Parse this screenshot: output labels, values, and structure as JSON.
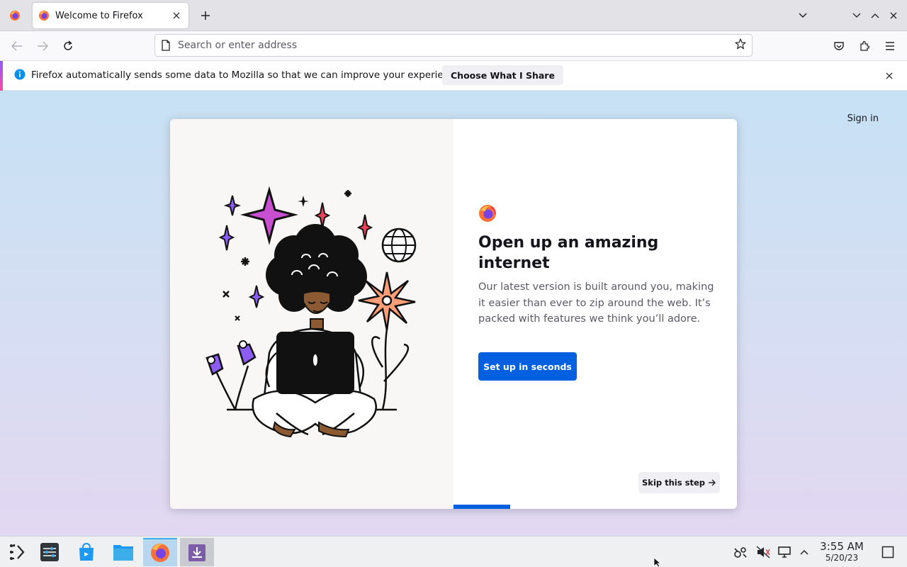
{
  "browser": {
    "tab": {
      "title": "Welcome to Firefox"
    },
    "urlbar": {
      "placeholder": "Search or enter address",
      "value": ""
    }
  },
  "notification": {
    "text": "Firefox automatically sends some data to Mozilla so that we can improve your experience.",
    "button_label": "Choose What I Share"
  },
  "page": {
    "sign_in_label": "Sign in",
    "headline": "Open up an amazing internet",
    "subtext": "Our latest version is built around you, making it easier than ever to zip around the web. It’s packed with features we think you’ll adore.",
    "primary_button": "Set up in seconds",
    "skip_button": "Skip this step",
    "progress_fraction": 0.2
  },
  "taskbar": {
    "time": "3:55 AM",
    "date": "5/20/23"
  },
  "colors": {
    "accent": "#0060df",
    "info_blue": "#0090ed",
    "taskbar_active": "#b6d7ee"
  },
  "icons": [
    "firefox-icon",
    "close-icon",
    "plus-icon",
    "chevron-down-icon",
    "back-icon",
    "forward-icon",
    "reload-icon",
    "page-icon",
    "star-icon",
    "pocket-icon",
    "extensions-icon",
    "menu-icon",
    "info-icon",
    "arrow-right-icon",
    "app-launcher-icon",
    "system-settings-icon",
    "discover-icon",
    "file-manager-icon",
    "installer-icon",
    "network-icon",
    "volume-muted-icon",
    "display-icon",
    "chevron-up-icon",
    "show-desktop-icon"
  ]
}
